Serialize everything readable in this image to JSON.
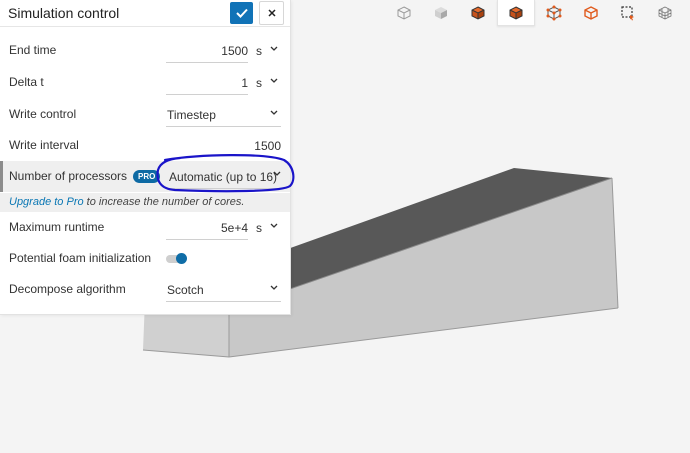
{
  "panel": {
    "title": "Simulation control",
    "end_time": {
      "label": "End time",
      "value": "1500",
      "unit": "s"
    },
    "delta_t": {
      "label": "Delta t",
      "value": "1",
      "unit": "s"
    },
    "write_control": {
      "label": "Write control",
      "value": "Timestep"
    },
    "write_interval": {
      "label": "Write interval",
      "value": "1500"
    },
    "processors": {
      "label": "Number of processors",
      "badge": "PRO",
      "value": "Automatic (up to 16)"
    },
    "upgrade": {
      "link": "Upgrade to Pro",
      "text": " to increase the number of cores."
    },
    "max_runtime": {
      "label": "Maximum runtime",
      "value": "5e+4",
      "unit": "s"
    },
    "foam_init": {
      "label": "Potential foam initialization",
      "enabled": true
    },
    "decompose": {
      "label": "Decompose algorithm",
      "value": "Scotch"
    }
  },
  "toolbar": {
    "icons": [
      "cube-outline-icon",
      "cube-solid-icon",
      "cube-surface-edges-icon",
      "cube-active-icon",
      "cube-vertices-icon",
      "cube-edges-icon",
      "box-select-icon",
      "cube-mesh-icon"
    ],
    "active_index": 3
  },
  "colors": {
    "accent": "#1173b7",
    "badge": "#0d6aa4",
    "link": "#0a77b4",
    "annotation": "#1a14c9",
    "viewport_bg": "#f4f4f4"
  }
}
